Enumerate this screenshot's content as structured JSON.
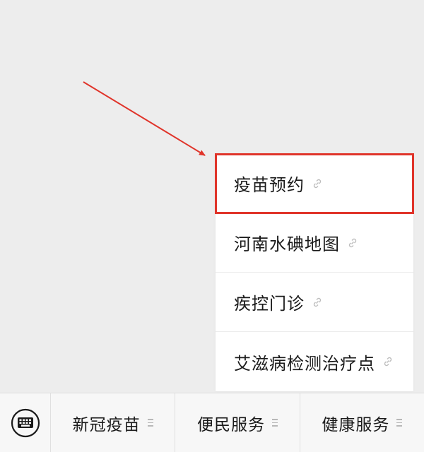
{
  "colors": {
    "background": "#ededed",
    "highlight": "#e0342a",
    "arrow": "#e0342a",
    "bar_background": "#f7f7f7"
  },
  "submenu": {
    "items": [
      {
        "label": "疫苗预约",
        "icon": "link-icon",
        "highlighted": true
      },
      {
        "label": "河南水碘地图",
        "icon": "link-icon",
        "highlighted": false
      },
      {
        "label": "疾控门诊",
        "icon": "link-icon",
        "highlighted": false
      },
      {
        "label": "艾滋病检测治疗点",
        "icon": "link-icon",
        "highlighted": false
      }
    ]
  },
  "bottom_bar": {
    "keyboard_icon": "keyboard-icon",
    "tabs": [
      {
        "label": "新冠疫苗",
        "icon": "menu-lines-icon"
      },
      {
        "label": "便民服务",
        "icon": "menu-lines-icon"
      },
      {
        "label": "健康服务",
        "icon": "menu-lines-icon"
      }
    ]
  }
}
